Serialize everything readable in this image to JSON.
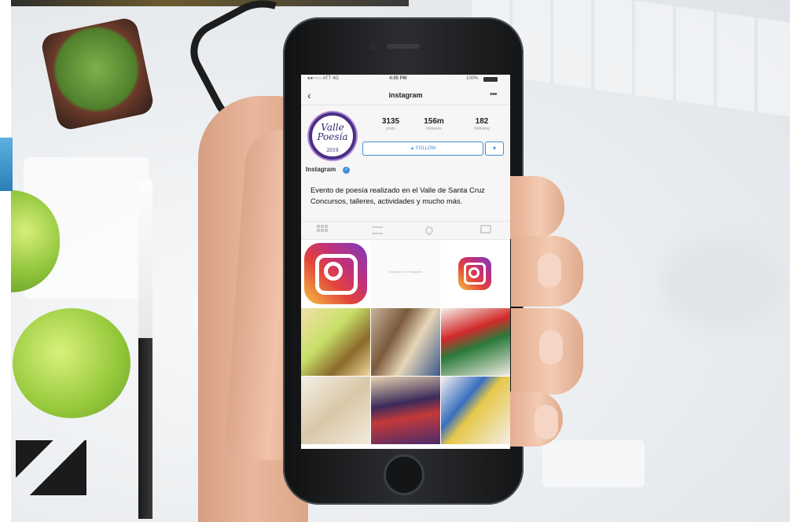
{
  "status_bar": {
    "carrier": "●●○○○ ATT  4G",
    "time": "4:05 PM",
    "battery": "100%"
  },
  "nav": {
    "back_icon": "chevron-left-icon",
    "title": "instagram",
    "more_icon": "more-horizontal-icon"
  },
  "profile": {
    "avatar_line1": "Valle",
    "avatar_line2": "Poesía",
    "avatar_year": "2019",
    "stats": [
      {
        "value": "3135",
        "label": "posts"
      },
      {
        "value": "156m",
        "label": "followers"
      },
      {
        "value": "182",
        "label": "following"
      }
    ],
    "follow_label": "▲ FOLLOW",
    "dropdown_label": "▾",
    "username": "Instagram",
    "verified_icon": "verified-badge-icon",
    "bio_line1": "Evento de poesía realizado en el Valle de Santa Cruz",
    "bio_line2": "Concursos, talleres, actividades y mucho más."
  },
  "tabs": [
    "grid-view-icon",
    "list-view-icon",
    "location-pin-icon",
    "tagged-photos-icon"
  ],
  "grid": {
    "tile2_caption": "Instagram on Instagram"
  },
  "colors": {
    "accent": "#3f8ed8",
    "avatar_ring": "#4a2f85",
    "instagram_gradient": [
      "#f5c143",
      "#e2443a",
      "#c2307a",
      "#7a3dbd"
    ]
  }
}
